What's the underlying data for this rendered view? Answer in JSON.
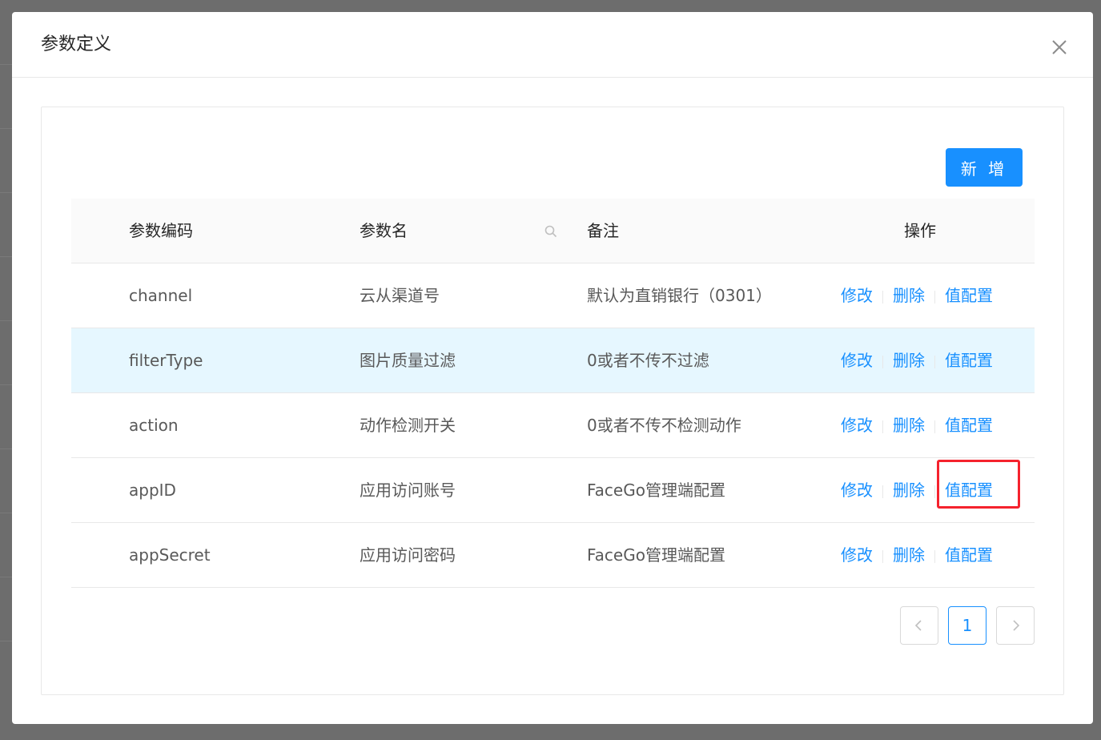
{
  "modal": {
    "title": "参数定义",
    "close_icon": "close-icon"
  },
  "toolbar": {
    "add_label": "新 增"
  },
  "table": {
    "columns": [
      "参数编码",
      "参数名",
      "备注",
      "操作"
    ],
    "filter_icon": "search-icon",
    "rows": [
      {
        "code": "channel",
        "name": "云从渠道号",
        "remark": "默认为直销银行（0301）",
        "actions": [
          "修改",
          "删除",
          "值配置"
        ]
      },
      {
        "code": "filterType",
        "name": "图片质量过滤",
        "remark": "0或者不传不过滤",
        "actions": [
          "修改",
          "删除",
          "值配置"
        ]
      },
      {
        "code": "action",
        "name": "动作检测开关",
        "remark": "0或者不传不检测动作",
        "actions": [
          "修改",
          "删除",
          "值配置"
        ]
      },
      {
        "code": "appID",
        "name": "应用访问账号",
        "remark": "FaceGo管理端配置",
        "actions": [
          "修改",
          "删除",
          "值配置"
        ]
      },
      {
        "code": "appSecret",
        "name": "应用访问密码",
        "remark": "FaceGo管理端配置",
        "actions": [
          "修改",
          "删除",
          "值配置"
        ]
      }
    ],
    "selected_row": 1,
    "highlighted_action": {
      "row": 3,
      "action": "值配置"
    }
  },
  "pagination": {
    "current_page": "1",
    "prev_icon": "chevron-left-icon",
    "next_icon": "chevron-right-icon"
  },
  "colors": {
    "primary": "#1890ff",
    "selected_row_bg": "#e6f7ff",
    "highlight_border": "#f5222d"
  }
}
